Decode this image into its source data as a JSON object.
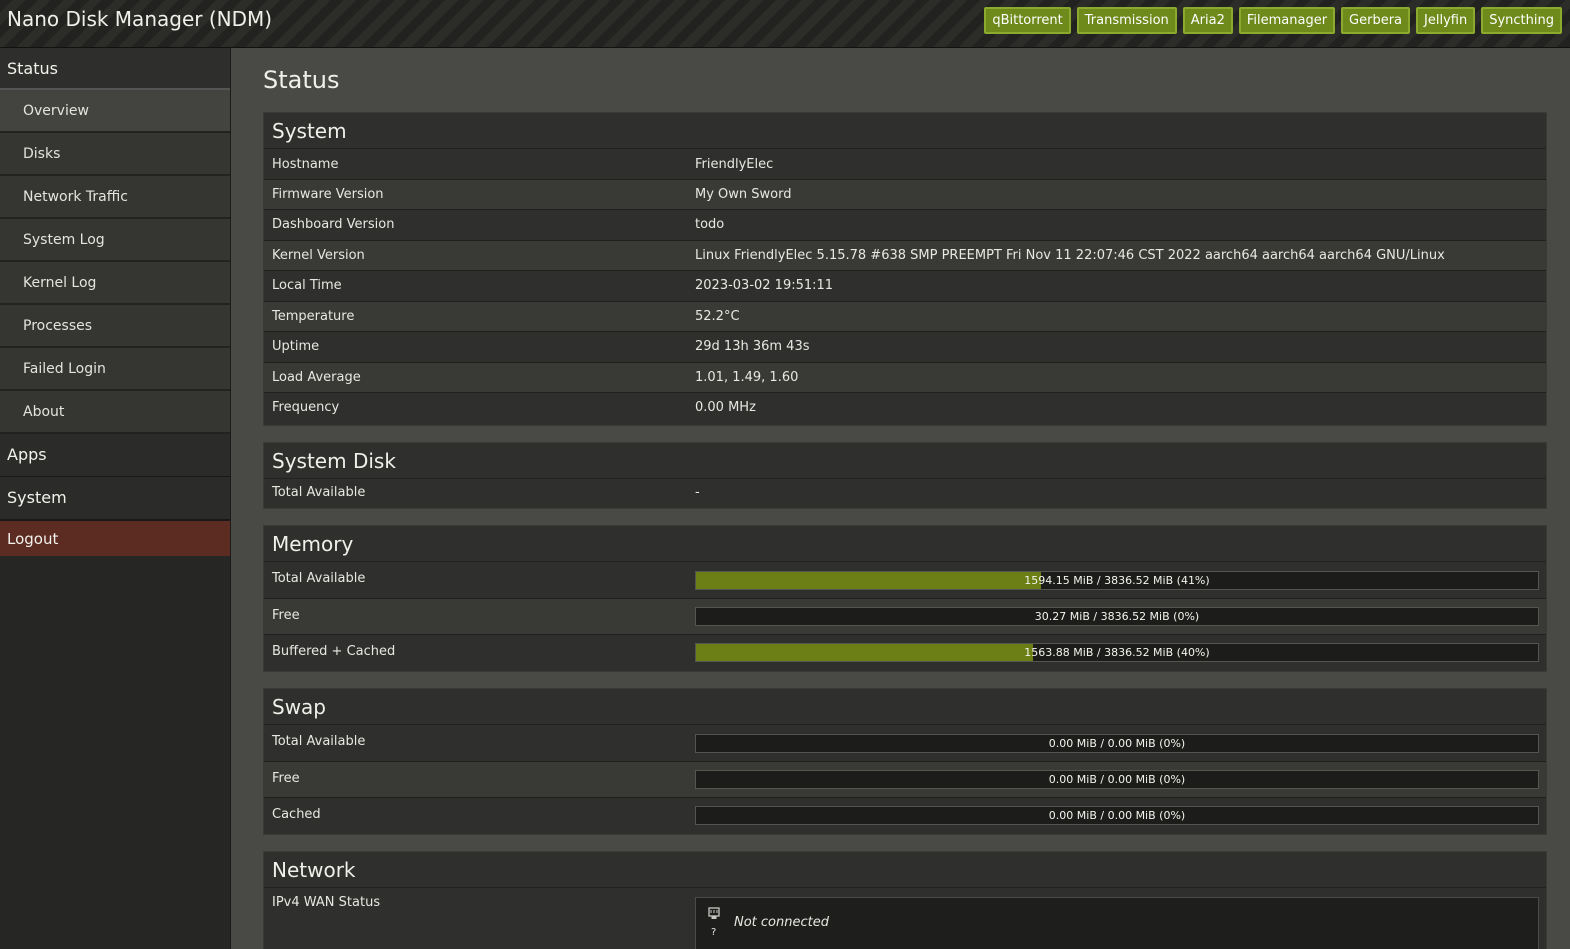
{
  "header": {
    "title": "Nano Disk Manager (NDM)",
    "apps": [
      "qBittorrent",
      "Transmission",
      "Aria2",
      "Filemanager",
      "Gerbera",
      "Jellyfin",
      "Syncthing"
    ]
  },
  "sidebar": {
    "status_label": "Status",
    "status_items": [
      "Overview",
      "Disks",
      "Network Traffic",
      "System Log",
      "Kernel Log",
      "Processes",
      "Failed Login",
      "About"
    ],
    "apps_label": "Apps",
    "system_label": "System",
    "logout_label": "Logout"
  },
  "page": {
    "title": "Status"
  },
  "system": {
    "heading": "System",
    "rows": [
      {
        "label": "Hostname",
        "value": "FriendlyElec"
      },
      {
        "label": "Firmware Version",
        "value": "My Own Sword"
      },
      {
        "label": "Dashboard Version",
        "value": "todo"
      },
      {
        "label": "Kernel Version",
        "value": "Linux FriendlyElec 5.15.78 #638 SMP PREEMPT Fri Nov 11 22:07:46 CST 2022 aarch64 aarch64 aarch64 GNU/Linux"
      },
      {
        "label": "Local Time",
        "value": "2023-03-02 19:51:11"
      },
      {
        "label": "Temperature",
        "value": "52.2°C"
      },
      {
        "label": "Uptime",
        "value": "29d 13h 36m 43s"
      },
      {
        "label": "Load Average",
        "value": "1.01, 1.49, 1.60"
      },
      {
        "label": "Frequency",
        "value": "0.00 MHz"
      }
    ]
  },
  "system_disk": {
    "heading": "System Disk",
    "rows": [
      {
        "label": "Total Available",
        "value": "-"
      }
    ]
  },
  "memory": {
    "heading": "Memory",
    "rows": [
      {
        "label": "Total Available",
        "text": "1594.15 MiB / 3836.52 MiB (41%)",
        "percent": 41
      },
      {
        "label": "Free",
        "text": "30.27 MiB / 3836.52 MiB (0%)",
        "percent": 0
      },
      {
        "label": "Buffered + Cached",
        "text": "1563.88 MiB / 3836.52 MiB (40%)",
        "percent": 40
      }
    ]
  },
  "swap": {
    "heading": "Swap",
    "rows": [
      {
        "label": "Total Available",
        "text": "0.00 MiB / 0.00 MiB (0%)",
        "percent": 0
      },
      {
        "label": "Free",
        "text": "0.00 MiB / 0.00 MiB (0%)",
        "percent": 0
      },
      {
        "label": "Cached",
        "text": "0.00 MiB / 0.00 MiB (0%)",
        "percent": 0
      }
    ]
  },
  "network": {
    "heading": "Network",
    "wan_label": "IPv4 WAN Status",
    "wan_icon_glyph": "?",
    "wan_status": "Not connected"
  },
  "colors": {
    "accent": "#6d8a1b",
    "bar_fill": "#6b7f16",
    "logout_bg": "#5c2b22"
  }
}
